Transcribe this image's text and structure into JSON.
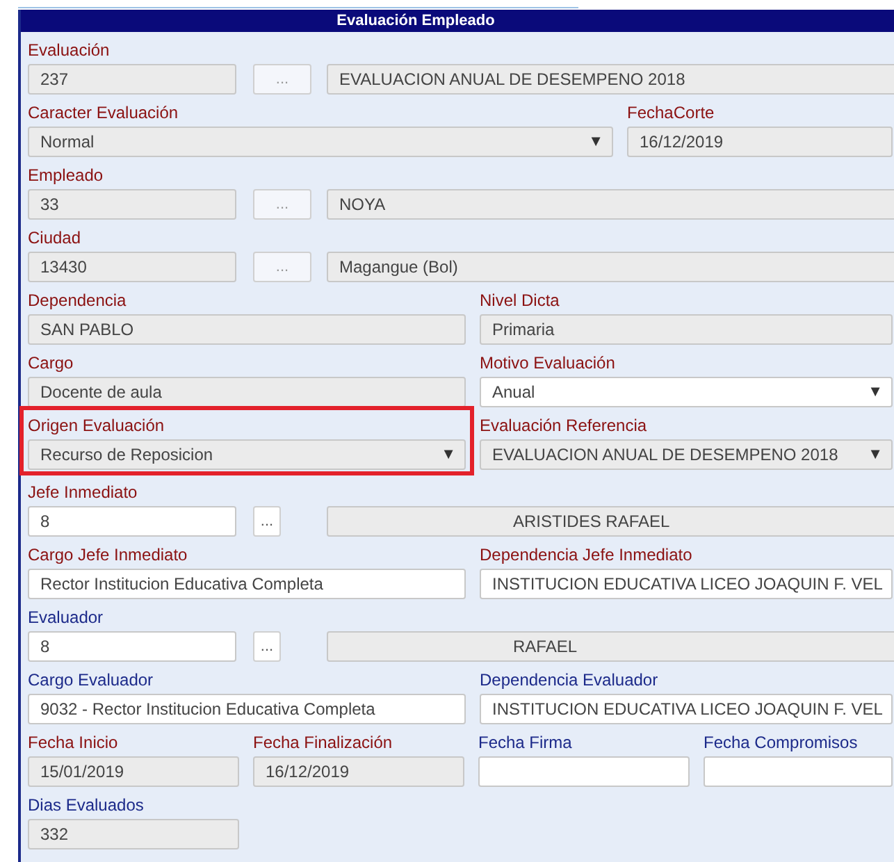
{
  "panel": {
    "title": "Evaluación Empleado"
  },
  "rows": [
    {
      "kind": "lookup",
      "label": "Evaluación",
      "required": true,
      "code": {
        "value": "237",
        "disabled": true
      },
      "button": {
        "label": "...",
        "disabled": true
      },
      "name": {
        "value": "EVALUACION ANUAL DE DESEMPENO 2018",
        "disabled": true
      }
    },
    {
      "kind": "wide",
      "fields": [
        {
          "label": "Caracter Evaluación",
          "required": true,
          "kind": "select",
          "value": "Normal",
          "arrow": "▼",
          "disabled": true
        },
        {
          "label": "FechaCorte",
          "required": true,
          "kind": "text",
          "value": "16/12/2019",
          "disabled": true
        }
      ]
    },
    {
      "kind": "lookup",
      "label": "Empleado",
      "required": true,
      "code": {
        "value": "33",
        "disabled": true
      },
      "button": {
        "label": "...",
        "disabled": true
      },
      "name": {
        "value": "NOYA",
        "disabled": true
      }
    },
    {
      "kind": "lookup",
      "label": "Ciudad",
      "required": true,
      "code": {
        "value": "13430",
        "disabled": true
      },
      "button": {
        "label": "...",
        "disabled": true
      },
      "name": {
        "value": "Magangue (Bol)",
        "disabled": true
      }
    },
    {
      "kind": "halves",
      "fields": [
        {
          "label": "Dependencia",
          "required": true,
          "kind": "text",
          "value": "SAN PABLO",
          "disabled": true
        },
        {
          "label": "Nivel Dicta",
          "required": true,
          "kind": "text",
          "value": "Primaria",
          "disabled": true
        }
      ]
    },
    {
      "kind": "halves",
      "fields": [
        {
          "label": "Cargo",
          "required": true,
          "kind": "text",
          "value": "Docente de aula",
          "disabled": true
        },
        {
          "label": "Motivo Evaluación",
          "required": true,
          "kind": "select",
          "value": "Anual",
          "arrow": "▼",
          "disabled": false
        }
      ]
    },
    {
      "kind": "halves",
      "fields": [
        {
          "label": "Origen Evaluación",
          "required": true,
          "kind": "select",
          "value": "Recurso de Reposicion",
          "arrow": "▼",
          "disabled": true,
          "highlighted": true
        },
        {
          "label": "Evaluación Referencia",
          "required": true,
          "kind": "select",
          "value": "EVALUACION ANUAL DE DESEMPENO 2018",
          "arrow": "▼",
          "disabled": true
        }
      ]
    },
    {
      "kind": "lookup",
      "label": "Jefe Inmediato",
      "required": true,
      "code": {
        "value": "8",
        "disabled": false
      },
      "button": {
        "label": "...",
        "disabled": false
      },
      "name": {
        "value": "ARISTIDES RAFAEL",
        "disabled": true
      }
    },
    {
      "kind": "halves",
      "fields": [
        {
          "label": "Cargo Jefe Inmediato",
          "required": true,
          "kind": "text",
          "value": "Rector Institucion Educativa Completa",
          "disabled": false
        },
        {
          "label": "Dependencia Jefe Inmediato",
          "required": true,
          "kind": "text",
          "value": "INSTITUCION EDUCATIVA LICEO JOAQUIN F. VEL",
          "disabled": false
        }
      ]
    },
    {
      "kind": "lookup",
      "label": "Evaluador",
      "required": false,
      "code": {
        "value": "8",
        "disabled": false
      },
      "button": {
        "label": "...",
        "disabled": false
      },
      "name": {
        "value": "RAFAEL",
        "disabled": true
      }
    },
    {
      "kind": "halves",
      "fields": [
        {
          "label": "Cargo Evaluador",
          "required": false,
          "kind": "text",
          "value": "9032 - Rector Institucion Educativa Completa",
          "disabled": false
        },
        {
          "label": "Dependencia Evaluador",
          "required": false,
          "kind": "text",
          "value": "INSTITUCION EDUCATIVA LICEO JOAQUIN F. VEL",
          "disabled": false
        }
      ]
    },
    {
      "kind": "quarters",
      "fields": [
        {
          "label": "Fecha Inicio",
          "required": true,
          "kind": "text",
          "value": "15/01/2019",
          "disabled": true
        },
        {
          "label": "Fecha Finalización",
          "required": true,
          "kind": "text",
          "value": "16/12/2019",
          "disabled": true
        },
        {
          "label": "Fecha Firma",
          "required": false,
          "kind": "text",
          "disabled": false
        },
        {
          "label": "Fecha Compromisos",
          "required": false,
          "kind": "text",
          "disabled": false
        }
      ]
    },
    {
      "kind": "quarters",
      "fields": [
        {
          "label": "Dias Evaluados",
          "required": false,
          "kind": "text",
          "value": "332",
          "disabled": true
        }
      ]
    }
  ]
}
